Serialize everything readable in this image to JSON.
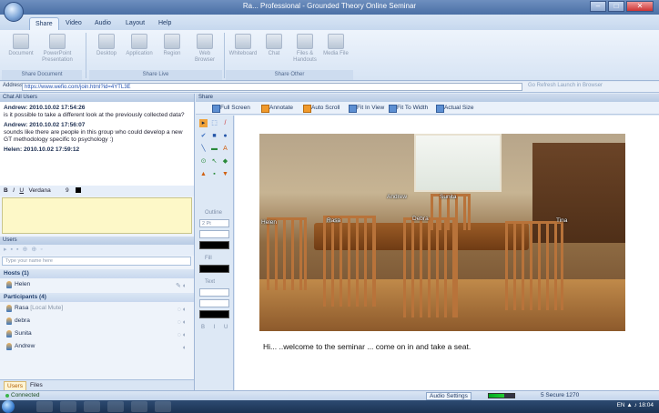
{
  "window": {
    "title": "Ra... Professional - Grounded Theory Online Seminar",
    "controls": [
      "–",
      "□",
      "✕"
    ]
  },
  "tabs": [
    "Share",
    "Video",
    "Audio",
    "Layout",
    "Help"
  ],
  "ribbon": {
    "document_group": {
      "label": "Share Document",
      "buttons": [
        "Document",
        "PowerPoint Presentation"
      ]
    },
    "live_group": {
      "label": "Share Live",
      "buttons": [
        "Desktop",
        "Application",
        "Region",
        "Web Browser"
      ]
    },
    "other_group": {
      "label": "Share Other",
      "buttons": [
        "Whiteboard",
        "Chat",
        "Files & Handouts",
        "Media File"
      ]
    }
  },
  "address": {
    "label": "Address",
    "value": "https://www.wefio.com/join.html?id=4YTL3E",
    "right_controls": "Go    Refresh    Launch in Browser"
  },
  "chat": {
    "header": "Chat All Users",
    "messages": [
      {
        "author": "Andrew: 2010.10.02 17:54:26",
        "text": "is it possible to take a different look at the previously collected data?"
      },
      {
        "author": "Andrew: 2010.10.02 17:56:07",
        "text": "sounds like there are people in this group who could develop a new GT methodology specific to psychology :)"
      },
      {
        "author": "Helen: 2010.10.02 17:59:12",
        "text": ""
      }
    ],
    "format": {
      "bold": "B",
      "italic": "I",
      "underline": "U",
      "font": "Verdana",
      "size": "9"
    }
  },
  "users": {
    "header": "Users",
    "search_placeholder": "Type your name here",
    "hosts_label": "Hosts (1)",
    "participants_label": "Participants (4)",
    "hosts": [
      {
        "name": "Helen",
        "note": ""
      }
    ],
    "participants": [
      {
        "name": "Rasa",
        "note": "[Local Mute]"
      },
      {
        "name": "debra",
        "note": ""
      },
      {
        "name": "Sunita",
        "note": ""
      },
      {
        "name": "Andrew",
        "note": ""
      }
    ],
    "tabs": [
      "Users",
      "Files"
    ]
  },
  "share": {
    "header": "Share",
    "toolbar": [
      "Full Screen",
      "Annotate",
      "Auto Scroll",
      "Fit In View",
      "Fit To Width",
      "Actual Size"
    ],
    "palette": {
      "outline_label": "Outline",
      "fill_label": "Fill",
      "text_label": "Text",
      "line_width": "2 Pt"
    },
    "photo_labels": [
      "Helen",
      "Rasa",
      "Debra",
      "Andrew",
      "Sunita",
      "Tina"
    ],
    "caption": "Hi... ..welcome to the seminar ... come on in and take a seat."
  },
  "status": {
    "text": "Connected",
    "audio_settings": "Audio Settings",
    "right": "5    Secure    1270"
  },
  "taskbar": {
    "tray": "EN  ▲  ♪  18:04"
  }
}
